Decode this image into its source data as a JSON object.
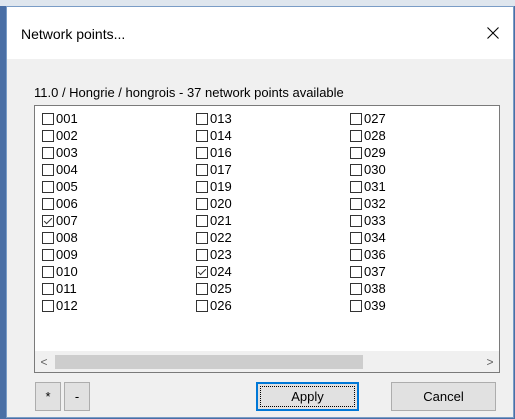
{
  "dialog": {
    "title": "Network points...",
    "close_label": "close"
  },
  "status": {
    "text": "11.0 / Hongrie / hongrois - 37 network points available"
  },
  "columns": [
    [
      {
        "label": "001",
        "checked": false
      },
      {
        "label": "002",
        "checked": false
      },
      {
        "label": "003",
        "checked": false
      },
      {
        "label": "004",
        "checked": false
      },
      {
        "label": "005",
        "checked": false
      },
      {
        "label": "006",
        "checked": false
      },
      {
        "label": "007",
        "checked": true
      },
      {
        "label": "008",
        "checked": false
      },
      {
        "label": "009",
        "checked": false
      },
      {
        "label": "010",
        "checked": false
      },
      {
        "label": "011",
        "checked": false
      },
      {
        "label": "012",
        "checked": false
      }
    ],
    [
      {
        "label": "013",
        "checked": false
      },
      {
        "label": "014",
        "checked": false
      },
      {
        "label": "016",
        "checked": false
      },
      {
        "label": "017",
        "checked": false
      },
      {
        "label": "019",
        "checked": false
      },
      {
        "label": "020",
        "checked": false
      },
      {
        "label": "021",
        "checked": false
      },
      {
        "label": "022",
        "checked": false
      },
      {
        "label": "023",
        "checked": false
      },
      {
        "label": "024",
        "checked": true
      },
      {
        "label": "025",
        "checked": false
      },
      {
        "label": "026",
        "checked": false
      }
    ],
    [
      {
        "label": "027",
        "checked": false
      },
      {
        "label": "028",
        "checked": false
      },
      {
        "label": "029",
        "checked": false
      },
      {
        "label": "030",
        "checked": false
      },
      {
        "label": "031",
        "checked": false
      },
      {
        "label": "032",
        "checked": false
      },
      {
        "label": "033",
        "checked": false
      },
      {
        "label": "034",
        "checked": false
      },
      {
        "label": "036",
        "checked": false
      },
      {
        "label": "037",
        "checked": false
      },
      {
        "label": "038",
        "checked": false
      },
      {
        "label": "039",
        "checked": false
      }
    ]
  ],
  "scrollbar": {
    "left_arrow": "<",
    "right_arrow": ">"
  },
  "buttons": {
    "select_all_label": "*",
    "select_none_label": "-",
    "apply_label": "Apply",
    "cancel_label": "Cancel"
  },
  "colors": {
    "accent": "#0078d7",
    "background": "#f0f0f0",
    "button_face": "#e1e1e1"
  }
}
